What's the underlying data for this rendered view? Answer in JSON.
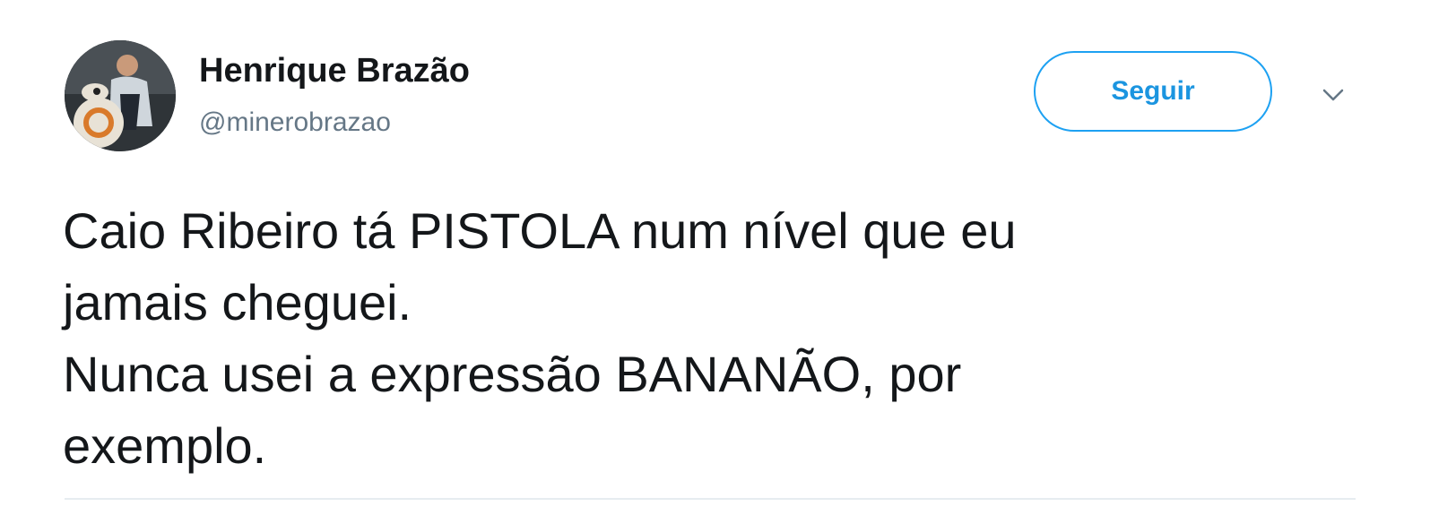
{
  "author": {
    "name": "Henrique Brazão",
    "handle": "@minerobrazao"
  },
  "actions": {
    "follow_label": "Seguir",
    "more_icon": "chevron-down-icon"
  },
  "tweet": {
    "lines": [
      "Caio Ribeiro tá PISTOLA num nível que eu",
      "jamais cheguei.",
      "Nunca usei a expressão BANANÃO, por",
      "exemplo."
    ]
  },
  "colors": {
    "accent": "#1da1f2",
    "text": "#14171a",
    "muted": "#657786"
  }
}
